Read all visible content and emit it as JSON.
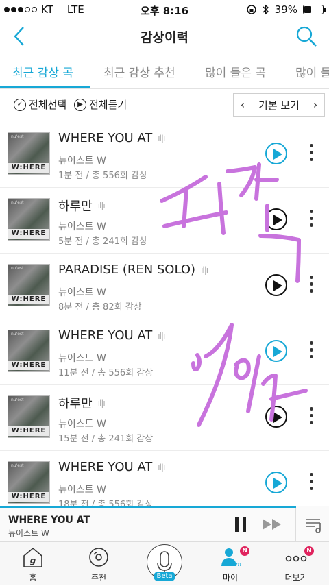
{
  "status_bar": {
    "carrier": "KT",
    "network": "LTE",
    "time": "오후 8:16",
    "battery": "39%",
    "battery_level": 0.39
  },
  "nav": {
    "title": "감상이력"
  },
  "tabs": [
    {
      "label": "최근 감상 곡",
      "active": true
    },
    {
      "label": "최근 감상 추천",
      "active": false
    },
    {
      "label": "많이 들은 곡",
      "active": false
    },
    {
      "label": "많이 들",
      "active": false
    }
  ],
  "toolbar": {
    "select_all": "전체선택",
    "play_all": "전체듣기",
    "view_mode": "기본 보기"
  },
  "tracks": [
    {
      "title": "WHERE YOU AT",
      "artist": "뉴이스트 W",
      "meta": "1분 전 / 총 556회 감상",
      "play_style": "blue"
    },
    {
      "title": "하루만",
      "artist": "뉴이스트 W",
      "meta": "5분 전 / 총 241회 감상",
      "play_style": "dark"
    },
    {
      "title": "PARADISE (REN SOLO)",
      "artist": "뉴이스트 W",
      "meta": "8분 전 / 총 82회 감상",
      "play_style": "dark"
    },
    {
      "title": "WHERE YOU AT",
      "artist": "뉴이스트 W",
      "meta": "11분 전 / 총 556회 감상",
      "play_style": "blue"
    },
    {
      "title": "하루만",
      "artist": "뉴이스트 W",
      "meta": "15분 전 / 총 241회 감상",
      "play_style": "dark"
    },
    {
      "title": "WHERE YOU AT",
      "artist": "뉴이스트 W",
      "meta": "18분 전 / 총 556회 감상",
      "play_style": "blue"
    }
  ],
  "album_art": {
    "label": "W:HERE"
  },
  "player": {
    "title": "WHERE YOU AT",
    "artist": "뉴이스트 W",
    "progress": 0.9
  },
  "bottom_nav": {
    "home": "홈",
    "recommend": "추천",
    "mic_badge": "Beta",
    "my": "마이",
    "more": "더보기",
    "new_badge": "N"
  },
  "colors": {
    "accent": "#17a8d6",
    "scribble": "#c873dd",
    "badge": "#e0245e"
  }
}
